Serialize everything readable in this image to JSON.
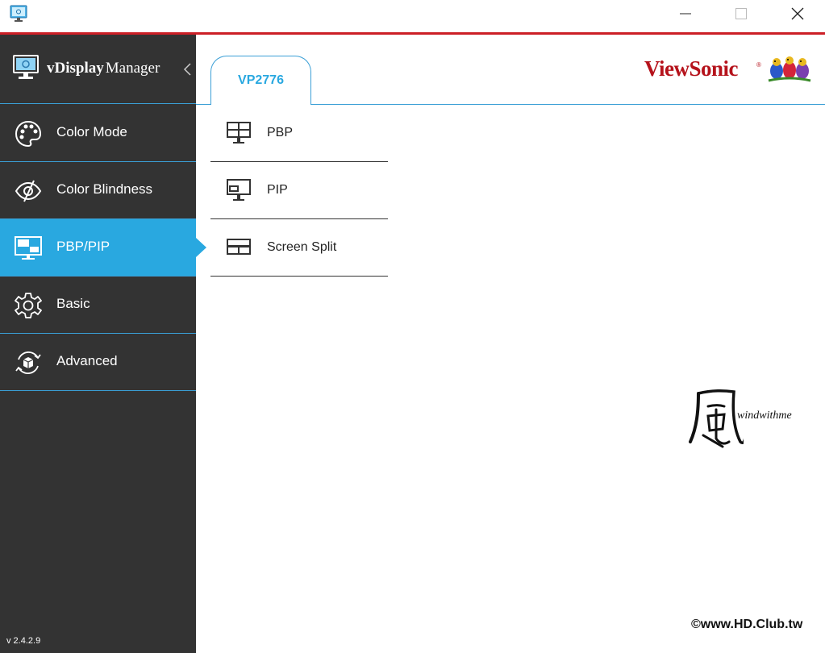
{
  "window": {
    "controls": {
      "minimize_icon": "minimize-icon",
      "maximize_icon": "maximize-icon",
      "close_icon": "close-icon"
    },
    "accent_color": "#cc1f26"
  },
  "sidebar": {
    "brand": {
      "title_bold": "vDisplay",
      "title_regular": "Manager"
    },
    "items": [
      {
        "label": "Color Mode",
        "icon": "palette-icon",
        "active": false
      },
      {
        "label": "Color Blindness",
        "icon": "eye-icon",
        "active": false
      },
      {
        "label": "PBP/PIP",
        "icon": "monitor-pip-icon",
        "active": true
      },
      {
        "label": "Basic",
        "icon": "gear-icon",
        "active": false
      },
      {
        "label": "Advanced",
        "icon": "advanced-box-icon",
        "active": false
      }
    ],
    "version": "v 2.4.2.9",
    "colors": {
      "background": "#333333",
      "active": "#29a8e0",
      "divider": "#3a9fd6"
    }
  },
  "main": {
    "tabs": [
      {
        "label": "VP2776",
        "active": true
      }
    ],
    "brand_logo": {
      "text": "ViewSonic",
      "reg_mark": "®"
    },
    "options": [
      {
        "label": "PBP",
        "icon": "pbp-layout-icon"
      },
      {
        "label": "PIP",
        "icon": "pip-layout-icon"
      },
      {
        "label": "Screen Split",
        "icon": "screen-split-icon"
      }
    ]
  },
  "overlay": {
    "watermark_text": "windwithme",
    "copyright": "©www.HD.Club.tw"
  }
}
